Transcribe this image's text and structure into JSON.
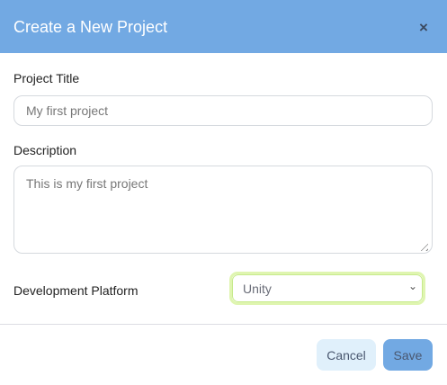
{
  "dialog": {
    "title": "Create a New Project",
    "close_icon": "×"
  },
  "form": {
    "project_title_label": "Project Title",
    "project_title_value": "My first project",
    "description_label": "Description",
    "description_value": "This is my first project",
    "platform_label": "Development Platform",
    "platform_value": "Unity",
    "chevron": "⌄"
  },
  "footer": {
    "cancel_label": "Cancel",
    "save_label": "Save"
  },
  "colors": {
    "header": "#72a9e3",
    "cancel_bg": "#e0f0fb",
    "select_focus": "#dff5b0"
  }
}
